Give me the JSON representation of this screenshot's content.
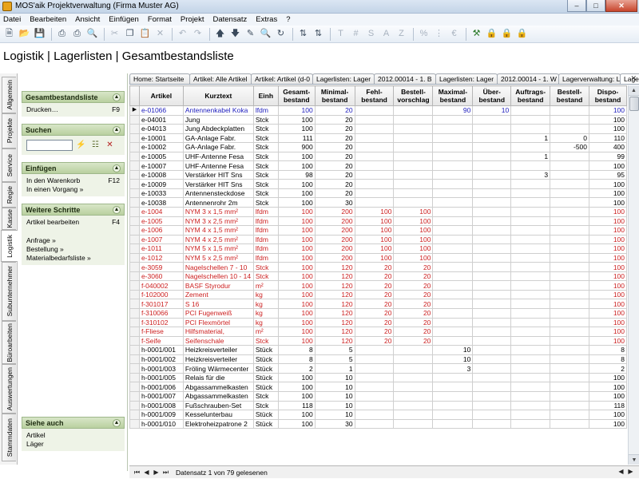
{
  "window": {
    "title": "MOS'aik Projektverwaltung (Firma Muster AG)"
  },
  "menu": [
    "Datei",
    "Bearbeiten",
    "Ansicht",
    "Einfügen",
    "Format",
    "Projekt",
    "Datensatz",
    "Extras",
    "?"
  ],
  "page_title": "Logistik | Lagerlisten | Gesamtbestandsliste",
  "vertical_tabs": [
    "Allgemein",
    "Projekte",
    "Service",
    "Regie",
    "Kasse",
    "Logistik",
    "Subunternehmer",
    "Büroarbeiten",
    "Auswertungen",
    "Stammdaten"
  ],
  "sidebar": {
    "section1": {
      "title": "Gesamtbestandsliste",
      "items": [
        {
          "label": "Drucken…",
          "key": "F9"
        }
      ]
    },
    "section2": {
      "title": "Suchen"
    },
    "section3": {
      "title": "Einfügen",
      "items": [
        {
          "label": "In den Warenkorb",
          "key": "F12"
        },
        {
          "label": "In einen Vorgang »",
          "key": ""
        }
      ]
    },
    "section4": {
      "title": "Weitere Schritte",
      "items": [
        {
          "label": "Artikel bearbeiten",
          "key": "F4"
        }
      ],
      "links": [
        "Anfrage »",
        "Bestellung »",
        "Materialbedarfsliste »"
      ]
    },
    "section5": {
      "title": "Siehe auch",
      "links": [
        "Artikel",
        "Läger"
      ]
    }
  },
  "tabs": [
    "Home: Startseite",
    "Artikel: Alle Artikel",
    "Artikel: Artikel (d-0",
    "Lagerlisten: Lager",
    "2012.00014 - 1. B",
    "Lagerlisten: Lager",
    "2012.00014 - 1. W",
    "Lagerverwaltung: La",
    "Lagerlisten: Gesamtbestandsliste"
  ],
  "table": {
    "headers": [
      "Artikel",
      "Kurztext",
      "Einh",
      "Gesamt-\nbestand",
      "Minimal-\nbestand",
      "Fehl-\nbestand",
      "Bestell-\nvorschlag",
      "Maximal-\nbestand",
      "Über-\nbestand",
      "Auftrags-\nbestand",
      "Bestell-\nbestand",
      "Dispo-\nbestand"
    ],
    "rows": [
      {
        "c": [
          "e-01066",
          "Antennenkabel Koka",
          "lfdm",
          "100",
          "20",
          "",
          "",
          "90",
          "10",
          "",
          "",
          "100"
        ],
        "color": "blue",
        "current": true
      },
      {
        "c": [
          "e-04001",
          "Jung",
          "Stck",
          "100",
          "20",
          "",
          "",
          "",
          "",
          "",
          "",
          "100"
        ],
        "color": "black"
      },
      {
        "c": [
          "e-04013",
          "Jung Abdeckplatten",
          "Stck",
          "100",
          "20",
          "",
          "",
          "",
          "",
          "",
          "",
          "100"
        ],
        "color": "black"
      },
      {
        "c": [
          "e-10001",
          "GA-Anlage Fabr.",
          "Stck",
          "111",
          "20",
          "",
          "",
          "",
          "",
          "1",
          "0",
          "110"
        ],
        "color": "black"
      },
      {
        "c": [
          "e-10002",
          "GA-Anlage Fabr.",
          "Stck",
          "900",
          "20",
          "",
          "",
          "",
          "",
          "",
          "-500",
          "400"
        ],
        "color": "black"
      },
      {
        "c": [
          "e-10005",
          "UHF-Antenne Fesa",
          "Stck",
          "100",
          "20",
          "",
          "",
          "",
          "",
          "1",
          "",
          "99"
        ],
        "color": "black"
      },
      {
        "c": [
          "e-10007",
          "UHF-Antenne Fesa",
          "Stck",
          "100",
          "20",
          "",
          "",
          "",
          "",
          "",
          "",
          "100"
        ],
        "color": "black"
      },
      {
        "c": [
          "e-10008",
          "Verstärker HIT Sns",
          "Stck",
          "98",
          "20",
          "",
          "",
          "",
          "",
          "3",
          "",
          "95"
        ],
        "color": "black"
      },
      {
        "c": [
          "e-10009",
          "Verstärker HIT Sns",
          "Stck",
          "100",
          "20",
          "",
          "",
          "",
          "",
          "",
          "",
          "100"
        ],
        "color": "black"
      },
      {
        "c": [
          "e-10033",
          "Antennensteckdose",
          "Stck",
          "100",
          "20",
          "",
          "",
          "",
          "",
          "",
          "",
          "100"
        ],
        "color": "black"
      },
      {
        "c": [
          "e-10038",
          "Antennenrohr 2m",
          "Stck",
          "100",
          "30",
          "",
          "",
          "",
          "",
          "",
          "",
          "100"
        ],
        "color": "black"
      },
      {
        "c": [
          "e-1004",
          "NYM 3 x 1,5 mm²",
          "lfdm",
          "100",
          "200",
          "100",
          "100",
          "",
          "",
          "",
          "",
          "100"
        ],
        "color": "red"
      },
      {
        "c": [
          "e-1005",
          "NYM 3 x 2,5 mm²",
          "lfdm",
          "100",
          "200",
          "100",
          "100",
          "",
          "",
          "",
          "",
          "100"
        ],
        "color": "red"
      },
      {
        "c": [
          "e-1006",
          "NYM 4 x 1,5 mm²",
          "lfdm",
          "100",
          "200",
          "100",
          "100",
          "",
          "",
          "",
          "",
          "100"
        ],
        "color": "red"
      },
      {
        "c": [
          "e-1007",
          "NYM 4 x 2,5 mm²",
          "lfdm",
          "100",
          "200",
          "100",
          "100",
          "",
          "",
          "",
          "",
          "100"
        ],
        "color": "red"
      },
      {
        "c": [
          "e-1011",
          "NYM 5 x 1,5 mm²",
          "lfdm",
          "100",
          "200",
          "100",
          "100",
          "",
          "",
          "",
          "",
          "100"
        ],
        "color": "red"
      },
      {
        "c": [
          "e-1012",
          "NYM 5 x 2,5 mm²",
          "lfdm",
          "100",
          "200",
          "100",
          "100",
          "",
          "",
          "",
          "",
          "100"
        ],
        "color": "red"
      },
      {
        "c": [
          "e-3059",
          "Nagelschellen 7 - 10",
          "Stck",
          "100",
          "120",
          "20",
          "20",
          "",
          "",
          "",
          "",
          "100"
        ],
        "color": "red"
      },
      {
        "c": [
          "e-3060",
          "Nagelschellen 10 - 14",
          "Stck",
          "100",
          "120",
          "20",
          "20",
          "",
          "",
          "",
          "",
          "100"
        ],
        "color": "red"
      },
      {
        "c": [
          "f-040002",
          "BASF Styrodur",
          "m²",
          "100",
          "120",
          "20",
          "20",
          "",
          "",
          "",
          "",
          "100"
        ],
        "color": "red"
      },
      {
        "c": [
          "f-102000",
          "Zement",
          "kg",
          "100",
          "120",
          "20",
          "20",
          "",
          "",
          "",
          "",
          "100"
        ],
        "color": "red"
      },
      {
        "c": [
          "f-301017",
          "S 16",
          "kg",
          "100",
          "120",
          "20",
          "20",
          "",
          "",
          "",
          "",
          "100"
        ],
        "color": "red"
      },
      {
        "c": [
          "f-310066",
          "PCI Fugenweiß",
          "kg",
          "100",
          "120",
          "20",
          "20",
          "",
          "",
          "",
          "",
          "100"
        ],
        "color": "red"
      },
      {
        "c": [
          "f-310102",
          "PCI Flexmörtel",
          "kg",
          "100",
          "120",
          "20",
          "20",
          "",
          "",
          "",
          "",
          "100"
        ],
        "color": "red"
      },
      {
        "c": [
          "f-Fliese",
          "Hilfsmaterial,",
          "m²",
          "100",
          "120",
          "20",
          "20",
          "",
          "",
          "",
          "",
          "100"
        ],
        "color": "red"
      },
      {
        "c": [
          "f-Seife",
          "Seifenschale",
          "Stck",
          "100",
          "120",
          "20",
          "20",
          "",
          "",
          "",
          "",
          "100"
        ],
        "color": "red"
      },
      {
        "c": [
          "h-0001/001",
          "Heizkreisverteiler",
          "Stück",
          "8",
          "5",
          "",
          "",
          "10",
          "",
          "",
          "",
          "8"
        ],
        "color": "black"
      },
      {
        "c": [
          "h-0001/002",
          "Heizkreisverteiler",
          "Stück",
          "8",
          "5",
          "",
          "",
          "10",
          "",
          "",
          "",
          "8"
        ],
        "color": "black"
      },
      {
        "c": [
          "h-0001/003",
          "Fröling Wärmecenter",
          "Stück",
          "2",
          "1",
          "",
          "",
          "3",
          "",
          "",
          "",
          "2"
        ],
        "color": "black"
      },
      {
        "c": [
          "h-0001/005",
          "Relais für die",
          "Stück",
          "100",
          "10",
          "",
          "",
          "",
          "",
          "",
          "",
          "100"
        ],
        "color": "black"
      },
      {
        "c": [
          "h-0001/006",
          "Abgassammelkasten",
          "Stück",
          "100",
          "10",
          "",
          "",
          "",
          "",
          "",
          "",
          "100"
        ],
        "color": "black"
      },
      {
        "c": [
          "h-0001/007",
          "Abgassammelkasten",
          "Stck",
          "100",
          "10",
          "",
          "",
          "",
          "",
          "",
          "",
          "100"
        ],
        "color": "black"
      },
      {
        "c": [
          "h-0001/008",
          "Fußschrauben-Set",
          "Stck",
          "118",
          "10",
          "",
          "",
          "",
          "",
          "",
          "",
          "118"
        ],
        "color": "black"
      },
      {
        "c": [
          "h-0001/009",
          "Kesselunterbau",
          "Stück",
          "100",
          "10",
          "",
          "",
          "",
          "",
          "",
          "",
          "100"
        ],
        "color": "black"
      },
      {
        "c": [
          "h-0001/010",
          "Elektroheizpatrone 2",
          "Stück",
          "100",
          "30",
          "",
          "",
          "",
          "",
          "",
          "",
          "100"
        ],
        "color": "black"
      }
    ]
  },
  "status": {
    "record_text": "Datensatz 1 von 79 gelesenen"
  }
}
